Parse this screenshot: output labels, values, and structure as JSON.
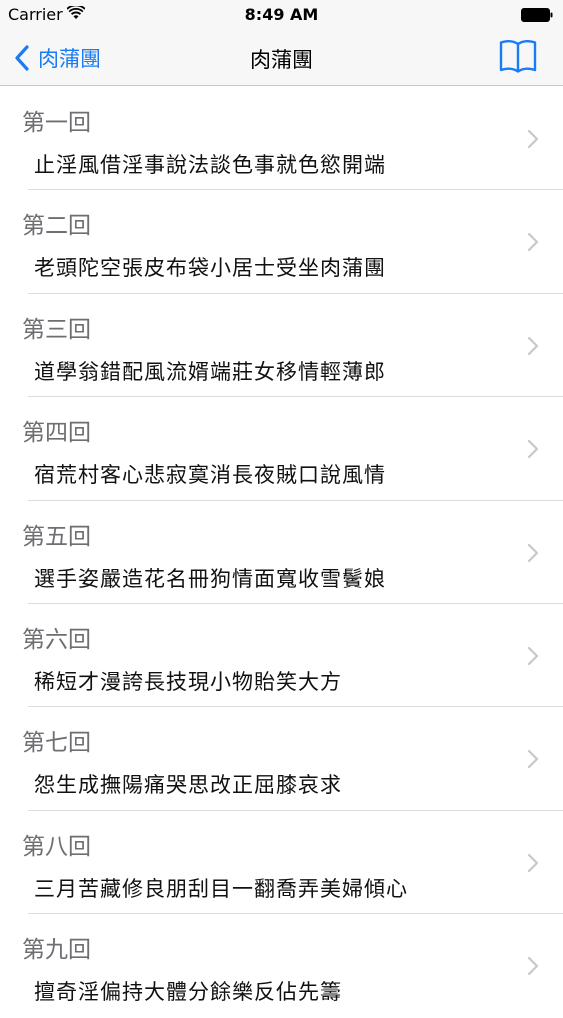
{
  "status_bar": {
    "carrier": "Carrier",
    "time": "8:49 AM"
  },
  "nav": {
    "back_label": "肉蒲團",
    "title": "肉蒲團",
    "accent_color": "#1a7cf5"
  },
  "chapters": [
    {
      "number": "第一回",
      "title": "止淫風借淫事說法談色事就色慾開端"
    },
    {
      "number": "第二回",
      "title": "老頭陀空張皮布袋小居士受坐肉蒲團"
    },
    {
      "number": "第三回",
      "title": "道學翁錯配風流婿端莊女移情輕薄郎"
    },
    {
      "number": "第四回",
      "title": "宿荒村客心悲寂寞消長夜賊口說風情"
    },
    {
      "number": "第五回",
      "title": "選手姿嚴造花名冊狗情面寬收雪鬢娘"
    },
    {
      "number": "第六回",
      "title": "稀短才漫誇長技現小物貽笑大方"
    },
    {
      "number": "第七回",
      "title": "怨生成撫陽痛哭思改正屈膝哀求"
    },
    {
      "number": "第八回",
      "title": "三月苦藏修良朋刮目一翻喬弄美婦傾心"
    },
    {
      "number": "第九回",
      "title": "擅奇淫偏持大體分餘樂反佔先籌"
    }
  ]
}
